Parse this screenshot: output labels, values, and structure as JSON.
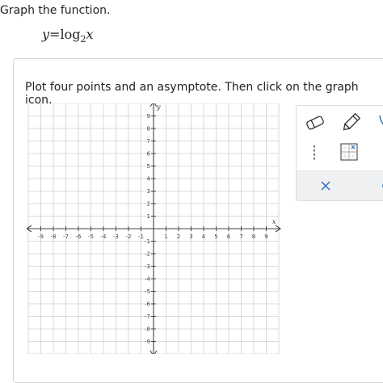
{
  "question": {
    "prompt": "Graph the function.",
    "equation": {
      "lhs": "y",
      "equals": "=",
      "func": "log",
      "base": "2",
      "arg": "x"
    }
  },
  "instruction": "Plot four points and an asymptote. Then click on the graph icon.",
  "graph": {
    "x_axis_label": "x",
    "y_axis_label": "y",
    "x_ticks": [
      "-9",
      "-8",
      "-7",
      "-6",
      "-5",
      "-4",
      "-3",
      "-2",
      "-1",
      "1",
      "2",
      "3",
      "4",
      "5",
      "6",
      "7",
      "8",
      "9"
    ],
    "y_ticks": [
      "9",
      "8",
      "7",
      "6",
      "5",
      "4",
      "3",
      "2",
      "1",
      "-1",
      "-2",
      "-3",
      "-4",
      "-5",
      "-6",
      "-7",
      "-8",
      "-9"
    ],
    "range": {
      "xmin": -10,
      "xmax": 10,
      "ymin": -10,
      "ymax": 10
    }
  },
  "tools": {
    "items": [
      {
        "name": "eraser-tool",
        "icon": "eraser-icon"
      },
      {
        "name": "pencil-tool",
        "icon": "pencil-icon"
      },
      {
        "name": "asymptote-tool",
        "icon": "dashed-line-icon"
      },
      {
        "name": "graph-submit-tool",
        "icon": "graph-icon"
      }
    ],
    "clear": "clear-icon",
    "undo": "undo-icon",
    "icon_color": "#2f6fb4",
    "panel_bg": "#eef0f2"
  }
}
